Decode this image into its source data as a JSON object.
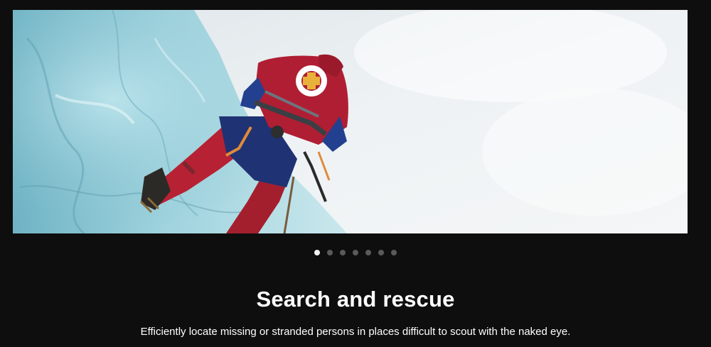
{
  "slider": {
    "total_slides": 7,
    "active_index": 0,
    "image_icon": "ice-climber-rescue-photo"
  },
  "slide": {
    "title": "Search and rescue",
    "description": "Efficiently locate missing or stranded persons in places difficult to scout with the naked eye."
  },
  "colors": {
    "background": "#0e0e0e",
    "dot_active": "#f2f2f2",
    "dot_inactive": "#5a5a5a",
    "text": "#ffffff"
  }
}
